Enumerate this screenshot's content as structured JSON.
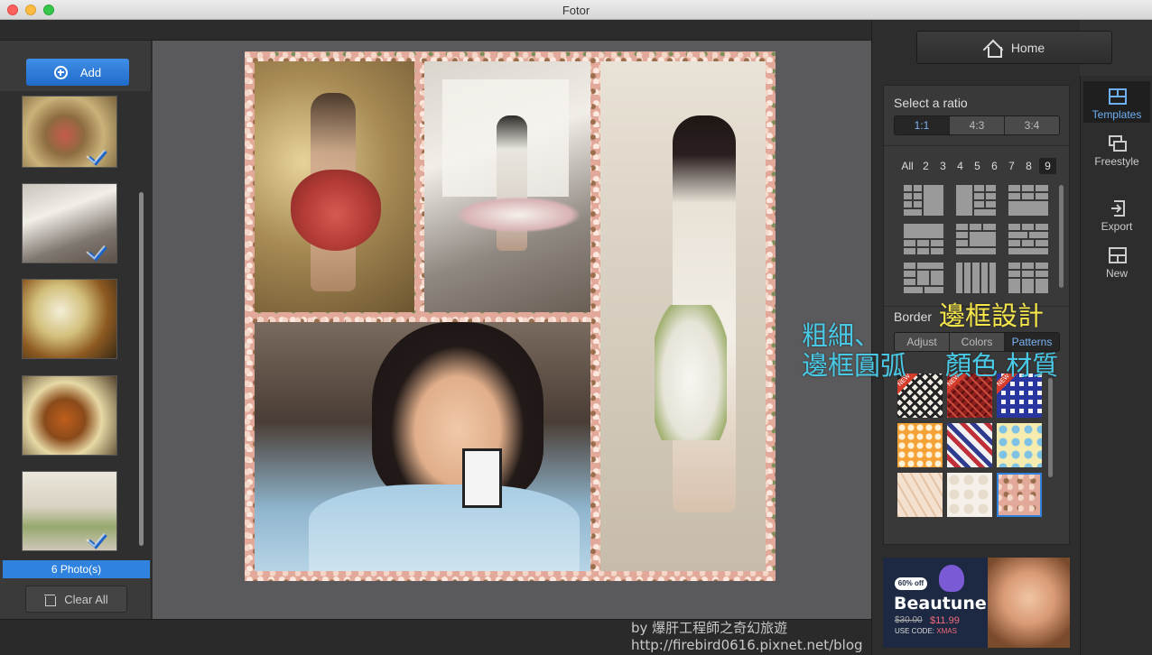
{
  "window": {
    "title": "Fotor"
  },
  "left_panel": {
    "add_label": "Add",
    "photo_count": "6 Photo(s)",
    "clear_label": "Clear All",
    "thumbnails": [
      {
        "name": "thumb-1",
        "checked": true
      },
      {
        "name": "thumb-2",
        "checked": true
      },
      {
        "name": "thumb-3",
        "checked": false
      },
      {
        "name": "thumb-4",
        "checked": false
      },
      {
        "name": "thumb-5",
        "checked": true
      }
    ]
  },
  "right_panel": {
    "home_label": "Home",
    "ratio": {
      "label": "Select a ratio",
      "options": [
        "1:1",
        "4:3",
        "3:4"
      ],
      "selected": "1:1"
    },
    "layout_counts": [
      "All",
      "2",
      "3",
      "4",
      "5",
      "6",
      "7",
      "8",
      "9"
    ],
    "layout_selected": "9",
    "border": {
      "label": "Border",
      "tabs": [
        "Adjust",
        "Colors",
        "Patterns"
      ],
      "selected": "Patterns",
      "new_badge": "NEW"
    },
    "ad": {
      "discount": "60% off",
      "brand": "Beautune",
      "price_old": "$30.00",
      "price_new": "$11.99",
      "code_label": "USE CODE:",
      "code": "XMAS"
    }
  },
  "toolbar": {
    "items": [
      {
        "label": "Templates",
        "icon": "templates-icon",
        "active": true
      },
      {
        "label": "Freestyle",
        "icon": "freestyle-icon",
        "active": false
      },
      {
        "label": "Export",
        "icon": "export-icon",
        "active": false
      },
      {
        "label": "New",
        "icon": "new-icon",
        "active": false
      }
    ]
  },
  "annotations": {
    "border_design": "邊框設計",
    "thickness": "粗細、",
    "frame_round": "邊框圓弧",
    "color_material": "顏色 材質"
  },
  "watermark": {
    "byline": "by 爆肝工程師之奇幻旅遊",
    "url": "http://firebird0616.pixnet.net/blog"
  },
  "colors": {
    "accent": "#2f83df",
    "annotation_yellow": "#f5e64b",
    "annotation_cyan": "#49c9e6"
  }
}
